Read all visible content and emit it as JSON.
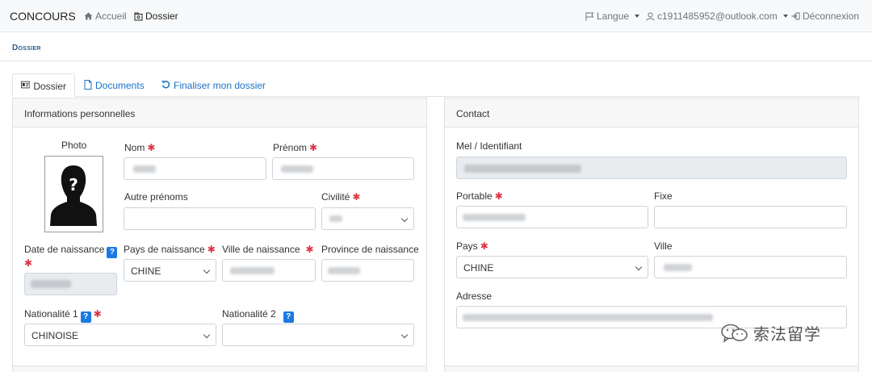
{
  "nav": {
    "brand": "CONCOURS",
    "home": "Accueil",
    "dossier": "Dossier",
    "langue": "Langue",
    "user_email": "c1911485952@outlook.com",
    "logout": "Déconnexion"
  },
  "page_title": "Dossier",
  "tabs": [
    {
      "label": "Dossier",
      "icon": "id-card-icon"
    },
    {
      "label": "Documents",
      "icon": "document-icon"
    },
    {
      "label": "Finaliser mon dossier",
      "icon": "undo-icon"
    }
  ],
  "personal": {
    "header": "Informations personnelles",
    "photo_label": "Photo",
    "nom": "Nom",
    "prenom": "Prénom",
    "autres_prenoms": "Autre prénoms",
    "civilite": "Civilité",
    "date_naissance": "Date de naissance",
    "pays_naissance": "Pays de naissance",
    "pays_naissance_value": "CHINE",
    "ville_naissance": "Ville de naissance",
    "province_naissance": "Province de naissance",
    "nationalite1": "Nationalité 1",
    "nationalite1_value": "CHINOISE",
    "nationalite2": "Nationalité 2"
  },
  "contact": {
    "header": "Contact",
    "mel": "Mel / Identifiant",
    "portable": "Portable",
    "fixe": "Fixe",
    "pays": "Pays",
    "pays_value": "CHINE",
    "ville": "Ville",
    "adresse": "Adresse"
  },
  "required_mark": "✱",
  "help_mark": "?",
  "watermark": "索法留学",
  "colors": {
    "link": "#1a73c7",
    "required": "#dc3545",
    "help": "#1a7ae2",
    "title": "#2c5b8c"
  }
}
